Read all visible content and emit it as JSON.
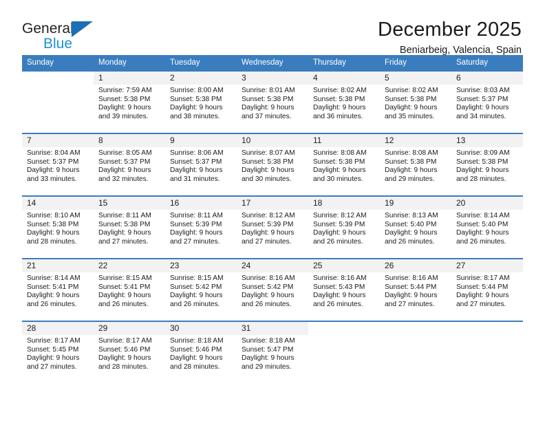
{
  "brand": {
    "name_top": "General",
    "name_bottom": "Blue",
    "accent_color": "#1b6fb5",
    "accent_color_light": "#1e8fd6"
  },
  "header": {
    "title": "December 2025",
    "subtitle": "Beniarbeig, Valencia, Spain"
  },
  "calendar": {
    "header_bg": "#3a7dbf",
    "daynum_bg": "#f2f2f2",
    "weekdays": [
      "Sunday",
      "Monday",
      "Tuesday",
      "Wednesday",
      "Thursday",
      "Friday",
      "Saturday"
    ],
    "weeks": [
      [
        {
          "day": "",
          "sunrise": "",
          "sunset": "",
          "daylight_line1": "",
          "daylight_line2": ""
        },
        {
          "day": "1",
          "sunrise": "Sunrise: 7:59 AM",
          "sunset": "Sunset: 5:38 PM",
          "daylight_line1": "Daylight: 9 hours",
          "daylight_line2": "and 39 minutes."
        },
        {
          "day": "2",
          "sunrise": "Sunrise: 8:00 AM",
          "sunset": "Sunset: 5:38 PM",
          "daylight_line1": "Daylight: 9 hours",
          "daylight_line2": "and 38 minutes."
        },
        {
          "day": "3",
          "sunrise": "Sunrise: 8:01 AM",
          "sunset": "Sunset: 5:38 PM",
          "daylight_line1": "Daylight: 9 hours",
          "daylight_line2": "and 37 minutes."
        },
        {
          "day": "4",
          "sunrise": "Sunrise: 8:02 AM",
          "sunset": "Sunset: 5:38 PM",
          "daylight_line1": "Daylight: 9 hours",
          "daylight_line2": "and 36 minutes."
        },
        {
          "day": "5",
          "sunrise": "Sunrise: 8:02 AM",
          "sunset": "Sunset: 5:38 PM",
          "daylight_line1": "Daylight: 9 hours",
          "daylight_line2": "and 35 minutes."
        },
        {
          "day": "6",
          "sunrise": "Sunrise: 8:03 AM",
          "sunset": "Sunset: 5:37 PM",
          "daylight_line1": "Daylight: 9 hours",
          "daylight_line2": "and 34 minutes."
        }
      ],
      [
        {
          "day": "7",
          "sunrise": "Sunrise: 8:04 AM",
          "sunset": "Sunset: 5:37 PM",
          "daylight_line1": "Daylight: 9 hours",
          "daylight_line2": "and 33 minutes."
        },
        {
          "day": "8",
          "sunrise": "Sunrise: 8:05 AM",
          "sunset": "Sunset: 5:37 PM",
          "daylight_line1": "Daylight: 9 hours",
          "daylight_line2": "and 32 minutes."
        },
        {
          "day": "9",
          "sunrise": "Sunrise: 8:06 AM",
          "sunset": "Sunset: 5:37 PM",
          "daylight_line1": "Daylight: 9 hours",
          "daylight_line2": "and 31 minutes."
        },
        {
          "day": "10",
          "sunrise": "Sunrise: 8:07 AM",
          "sunset": "Sunset: 5:38 PM",
          "daylight_line1": "Daylight: 9 hours",
          "daylight_line2": "and 30 minutes."
        },
        {
          "day": "11",
          "sunrise": "Sunrise: 8:08 AM",
          "sunset": "Sunset: 5:38 PM",
          "daylight_line1": "Daylight: 9 hours",
          "daylight_line2": "and 30 minutes."
        },
        {
          "day": "12",
          "sunrise": "Sunrise: 8:08 AM",
          "sunset": "Sunset: 5:38 PM",
          "daylight_line1": "Daylight: 9 hours",
          "daylight_line2": "and 29 minutes."
        },
        {
          "day": "13",
          "sunrise": "Sunrise: 8:09 AM",
          "sunset": "Sunset: 5:38 PM",
          "daylight_line1": "Daylight: 9 hours",
          "daylight_line2": "and 28 minutes."
        }
      ],
      [
        {
          "day": "14",
          "sunrise": "Sunrise: 8:10 AM",
          "sunset": "Sunset: 5:38 PM",
          "daylight_line1": "Daylight: 9 hours",
          "daylight_line2": "and 28 minutes."
        },
        {
          "day": "15",
          "sunrise": "Sunrise: 8:11 AM",
          "sunset": "Sunset: 5:38 PM",
          "daylight_line1": "Daylight: 9 hours",
          "daylight_line2": "and 27 minutes."
        },
        {
          "day": "16",
          "sunrise": "Sunrise: 8:11 AM",
          "sunset": "Sunset: 5:39 PM",
          "daylight_line1": "Daylight: 9 hours",
          "daylight_line2": "and 27 minutes."
        },
        {
          "day": "17",
          "sunrise": "Sunrise: 8:12 AM",
          "sunset": "Sunset: 5:39 PM",
          "daylight_line1": "Daylight: 9 hours",
          "daylight_line2": "and 27 minutes."
        },
        {
          "day": "18",
          "sunrise": "Sunrise: 8:12 AM",
          "sunset": "Sunset: 5:39 PM",
          "daylight_line1": "Daylight: 9 hours",
          "daylight_line2": "and 26 minutes."
        },
        {
          "day": "19",
          "sunrise": "Sunrise: 8:13 AM",
          "sunset": "Sunset: 5:40 PM",
          "daylight_line1": "Daylight: 9 hours",
          "daylight_line2": "and 26 minutes."
        },
        {
          "day": "20",
          "sunrise": "Sunrise: 8:14 AM",
          "sunset": "Sunset: 5:40 PM",
          "daylight_line1": "Daylight: 9 hours",
          "daylight_line2": "and 26 minutes."
        }
      ],
      [
        {
          "day": "21",
          "sunrise": "Sunrise: 8:14 AM",
          "sunset": "Sunset: 5:41 PM",
          "daylight_line1": "Daylight: 9 hours",
          "daylight_line2": "and 26 minutes."
        },
        {
          "day": "22",
          "sunrise": "Sunrise: 8:15 AM",
          "sunset": "Sunset: 5:41 PM",
          "daylight_line1": "Daylight: 9 hours",
          "daylight_line2": "and 26 minutes."
        },
        {
          "day": "23",
          "sunrise": "Sunrise: 8:15 AM",
          "sunset": "Sunset: 5:42 PM",
          "daylight_line1": "Daylight: 9 hours",
          "daylight_line2": "and 26 minutes."
        },
        {
          "day": "24",
          "sunrise": "Sunrise: 8:16 AM",
          "sunset": "Sunset: 5:42 PM",
          "daylight_line1": "Daylight: 9 hours",
          "daylight_line2": "and 26 minutes."
        },
        {
          "day": "25",
          "sunrise": "Sunrise: 8:16 AM",
          "sunset": "Sunset: 5:43 PM",
          "daylight_line1": "Daylight: 9 hours",
          "daylight_line2": "and 26 minutes."
        },
        {
          "day": "26",
          "sunrise": "Sunrise: 8:16 AM",
          "sunset": "Sunset: 5:44 PM",
          "daylight_line1": "Daylight: 9 hours",
          "daylight_line2": "and 27 minutes."
        },
        {
          "day": "27",
          "sunrise": "Sunrise: 8:17 AM",
          "sunset": "Sunset: 5:44 PM",
          "daylight_line1": "Daylight: 9 hours",
          "daylight_line2": "and 27 minutes."
        }
      ],
      [
        {
          "day": "28",
          "sunrise": "Sunrise: 8:17 AM",
          "sunset": "Sunset: 5:45 PM",
          "daylight_line1": "Daylight: 9 hours",
          "daylight_line2": "and 27 minutes."
        },
        {
          "day": "29",
          "sunrise": "Sunrise: 8:17 AM",
          "sunset": "Sunset: 5:46 PM",
          "daylight_line1": "Daylight: 9 hours",
          "daylight_line2": "and 28 minutes."
        },
        {
          "day": "30",
          "sunrise": "Sunrise: 8:18 AM",
          "sunset": "Sunset: 5:46 PM",
          "daylight_line1": "Daylight: 9 hours",
          "daylight_line2": "and 28 minutes."
        },
        {
          "day": "31",
          "sunrise": "Sunrise: 8:18 AM",
          "sunset": "Sunset: 5:47 PM",
          "daylight_line1": "Daylight: 9 hours",
          "daylight_line2": "and 29 minutes."
        },
        {
          "day": "",
          "sunrise": "",
          "sunset": "",
          "daylight_line1": "",
          "daylight_line2": ""
        },
        {
          "day": "",
          "sunrise": "",
          "sunset": "",
          "daylight_line1": "",
          "daylight_line2": ""
        },
        {
          "day": "",
          "sunrise": "",
          "sunset": "",
          "daylight_line1": "",
          "daylight_line2": ""
        }
      ]
    ]
  }
}
